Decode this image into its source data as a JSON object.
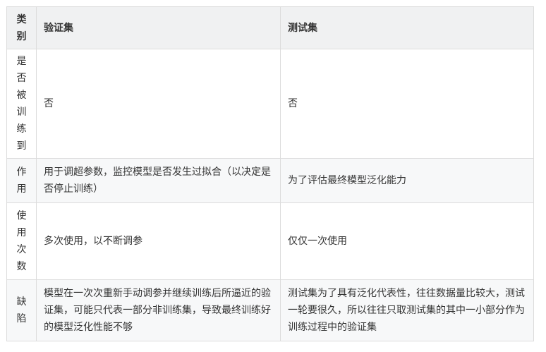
{
  "table": {
    "headers": [
      "类别",
      "验证集",
      "测试集"
    ],
    "rows": [
      {
        "category": "是否被训练到",
        "validation": "否",
        "test": "否"
      },
      {
        "category": "作用",
        "validation": "用于调超参数，监控模型是否发生过拟合（以决定是否停止训练）",
        "test": "为了评估最终模型泛化能力"
      },
      {
        "category": "使用次数",
        "validation": "多次使用，以不断调参",
        "test": "仅仅一次使用"
      },
      {
        "category": "缺陷",
        "validation": "模型在一次次重新手动调参并继续训练后所逼近的验证集，可能只代表一部分非训练集，导致最终训练好的模型泛化性能不够",
        "test": "测试集为了具有泛化代表性，往往数据量比较大，测试一轮要很久，所以往往只取测试集的其中一小部分作为训练过程中的验证集"
      }
    ]
  }
}
